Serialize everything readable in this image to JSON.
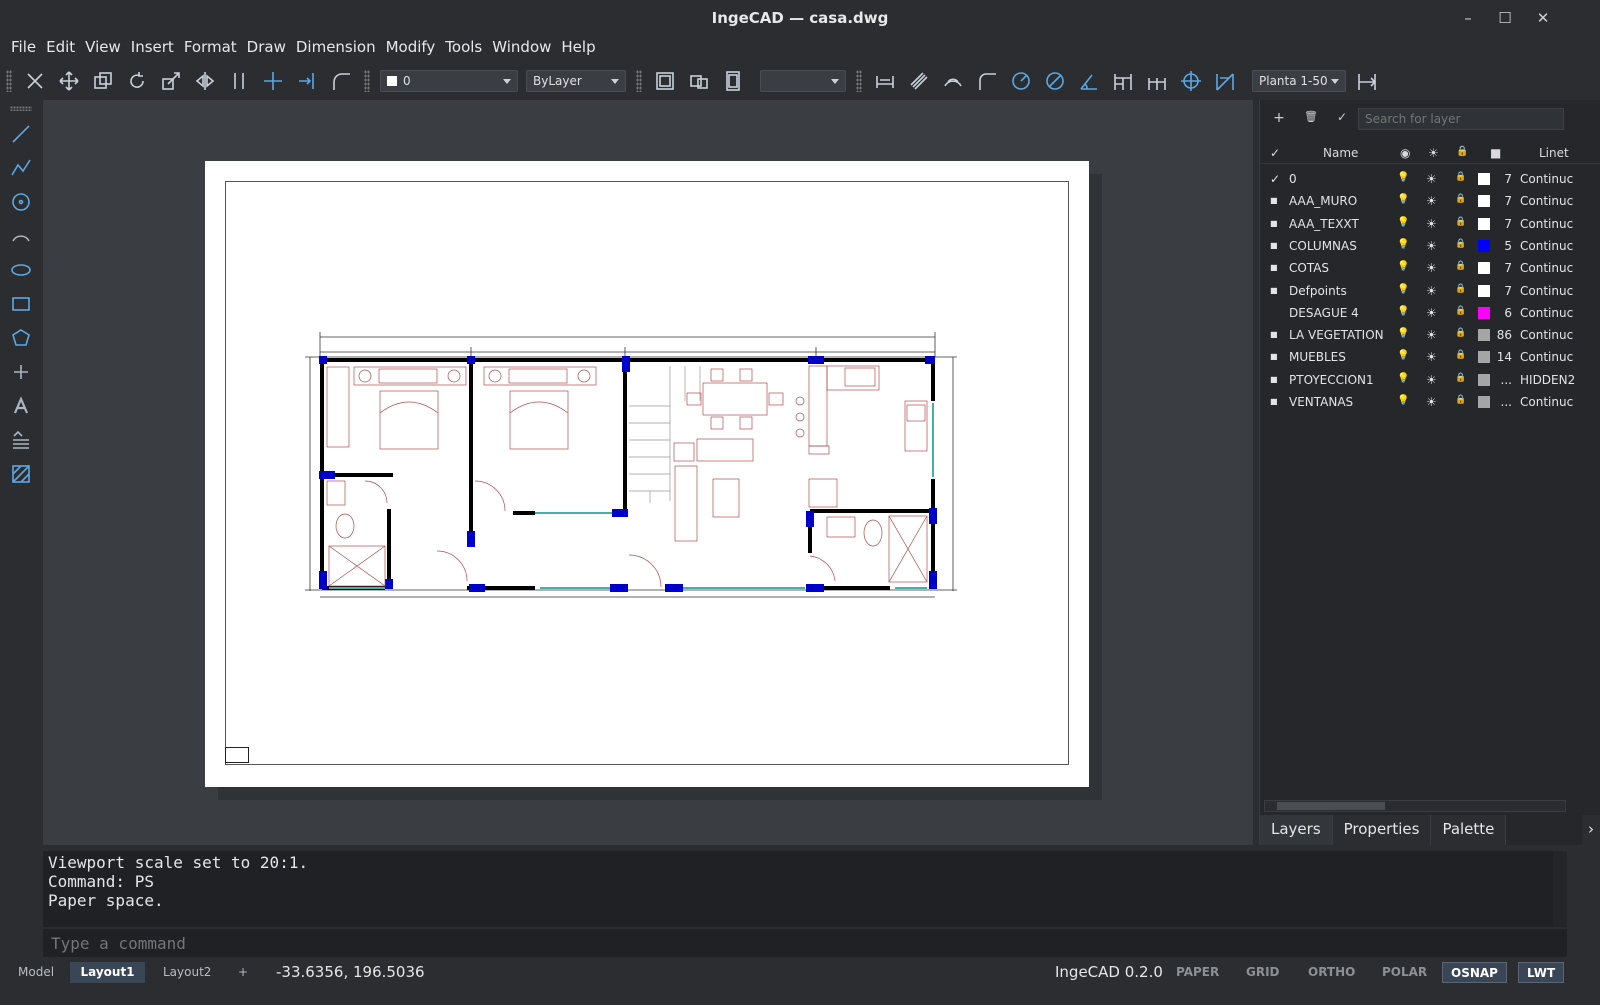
{
  "window": {
    "title": "IngeCAD — casa.dwg",
    "minimize": "–",
    "maximize": "☐",
    "close": "✕"
  },
  "menu": [
    "File",
    "Edit",
    "View",
    "Insert",
    "Format",
    "Draw",
    "Dimension",
    "Modify",
    "Tools",
    "Window",
    "Help"
  ],
  "toolbar": {
    "layer_combo": "0",
    "linetype_combo": "ByLayer",
    "empty_combo": "",
    "scale_combo": "Planta 1-50"
  },
  "layers_panel": {
    "add": "+",
    "delete": "🗑",
    "set_current": "✓",
    "search_placeholder": "Search for layer",
    "header": {
      "check": "✓",
      "name": "Name",
      "on": "◉",
      "freeze": "☀",
      "lock": "🔒",
      "color": "■",
      "linetype": "Linet"
    },
    "layers": [
      {
        "current": "✓",
        "name": "0",
        "on": "💡",
        "freeze": "☀",
        "lock": "🔒",
        "color": "#ffffff",
        "color_index": "7",
        "linetype": "Continuc"
      },
      {
        "current": "■",
        "name": "AAA_MURO",
        "on": "💡",
        "freeze": "☀",
        "lock": "🔒",
        "color": "#ffffff",
        "color_index": "7",
        "linetype": "Continuc"
      },
      {
        "current": "■",
        "name": "AAA_TEXXT",
        "on": "💡",
        "freeze": "☀",
        "lock": "🔒",
        "color": "#ffffff",
        "color_index": "7",
        "linetype": "Continuc"
      },
      {
        "current": "■",
        "name": "COLUMNAS",
        "on": "💡",
        "freeze": "☀",
        "lock": "🔒",
        "color": "#0000ff",
        "color_index": "5",
        "linetype": "Continuc"
      },
      {
        "current": "■",
        "name": "COTAS",
        "on": "💡",
        "freeze": "☀",
        "lock": "🔒",
        "color": "#ffffff",
        "color_index": "7",
        "linetype": "Continuc"
      },
      {
        "current": "■",
        "name": "Defpoints",
        "on": "💡",
        "freeze": "☀",
        "lock": "🔒",
        "color": "#ffffff",
        "color_index": "7",
        "linetype": "Continuc"
      },
      {
        "current": "",
        "name": "DESAGUE 4",
        "on": "💡",
        "freeze": "☀",
        "lock": "🔒",
        "color": "#ff00ff",
        "color_index": "6",
        "linetype": "Continuc"
      },
      {
        "current": "■",
        "name": "LA VEGETATION",
        "on": "💡",
        "freeze": "☀",
        "lock": "🔒",
        "color": "#a5a5a5",
        "color_index": "86",
        "linetype": "Continuc"
      },
      {
        "current": "■",
        "name": "MUEBLES",
        "on": "💡",
        "freeze": "☀",
        "lock": "🔒",
        "color": "#a5a5a5",
        "color_index": "14",
        "linetype": "Continuc"
      },
      {
        "current": "■",
        "name": "PTOYECCION1",
        "on": "💡",
        "freeze": "☀",
        "lock": "🔒",
        "color": "#a5a5a5",
        "color_index": "...",
        "linetype": "HIDDEN2"
      },
      {
        "current": "■",
        "name": "VENTANAS",
        "on": "💡",
        "freeze": "☀",
        "lock": "🔒",
        "color": "#a5a5a5",
        "color_index": "...",
        "linetype": "Continuc"
      }
    ],
    "tabs": [
      "Layers",
      "Properties",
      "Palette"
    ],
    "tabs_more": "›"
  },
  "command": {
    "history": [
      "Viewport scale set to 20:1.",
      "Command: PS",
      "Paper space."
    ],
    "input_placeholder": "Type a command"
  },
  "status": {
    "tabs": [
      "Model",
      "Layout1",
      "Layout2",
      "+"
    ],
    "coords": "-33.6356, 196.5036",
    "version": "IngeCAD 0.2.0",
    "toggles": [
      "PAPER",
      "GRID",
      "ORTHO",
      "POLAR",
      "OSNAP",
      "LWT"
    ]
  }
}
